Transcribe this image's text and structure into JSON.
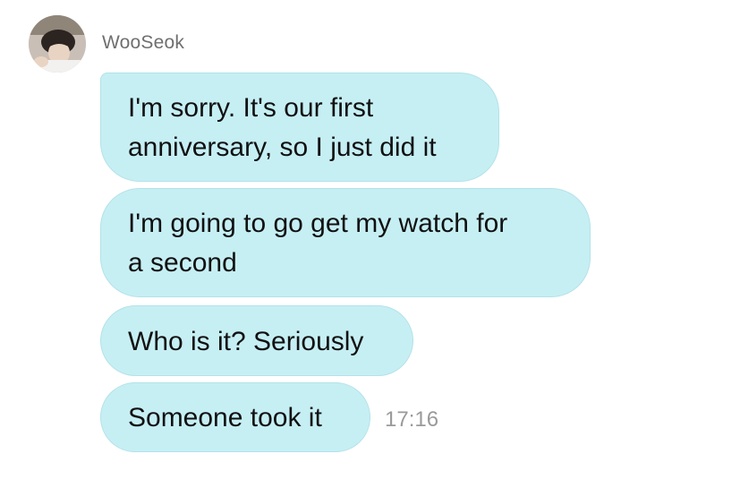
{
  "sender": {
    "name": "WooSeok"
  },
  "messages": [
    {
      "lines": [
        "I'm sorry. It's our first",
        "anniversary, so I just did it"
      ]
    },
    {
      "lines": [
        "I'm going to go get my watch for",
        "a second"
      ]
    },
    {
      "lines": [
        "Who is it? Seriously"
      ]
    },
    {
      "lines": [
        "Someone took it"
      ]
    }
  ],
  "last_message_time": "17:16",
  "colors": {
    "bubble": "#c6eff4",
    "bubble_border": "#b3e2e8",
    "sender_name": "#6f6f6f",
    "timestamp": "#9a9a9a"
  }
}
